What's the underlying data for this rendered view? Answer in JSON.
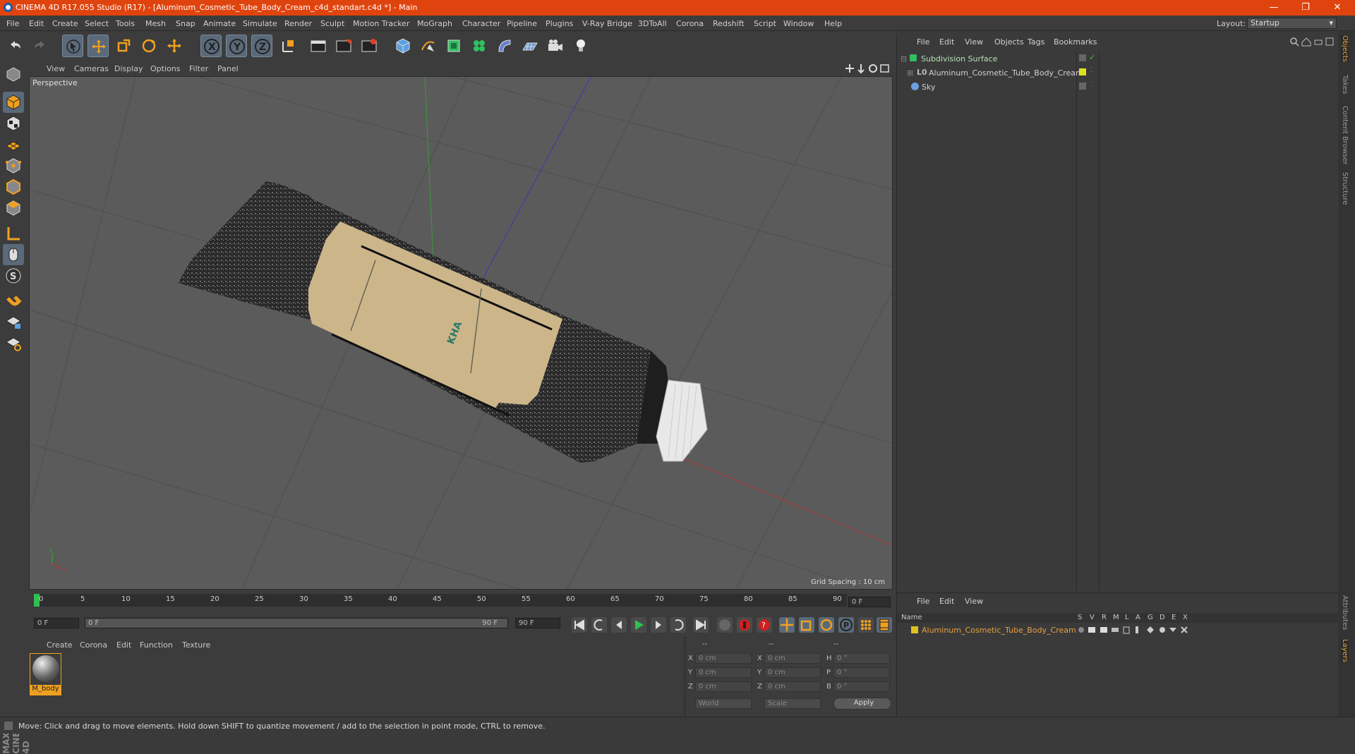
{
  "window": {
    "title": "CINEMA 4D R17.055 Studio (R17) - [Aluminum_Cosmetic_Tube_Body_Cream_c4d_standart.c4d *] - Main",
    "minimize": "—",
    "maximize": "❐",
    "close": "✕"
  },
  "menu": [
    "File",
    "Edit",
    "Create",
    "Select",
    "Tools",
    "Mesh",
    "Snap",
    "Animate",
    "Simulate",
    "Render",
    "Sculpt",
    "Motion Tracker",
    "MoGraph",
    "Character",
    "Pipeline",
    "Plugins",
    "V-Ray Bridge",
    "3DToAll",
    "Corona",
    "Redshift",
    "Script",
    "Window",
    "Help"
  ],
  "layout": {
    "label": "Layout:",
    "value": "Startup"
  },
  "viewport": {
    "menu": [
      "View",
      "Cameras",
      "Display",
      "Options",
      "Filter",
      "Panel"
    ],
    "camera": "Perspective",
    "grid_spacing": "Grid Spacing : 10 cm"
  },
  "timeline": {
    "labels": [
      "0",
      "5",
      "10",
      "15",
      "20",
      "25",
      "30",
      "35",
      "40",
      "45",
      "50",
      "55",
      "60",
      "65",
      "70",
      "75",
      "80",
      "85",
      "90"
    ],
    "current_frame": "0 F",
    "start_frame": "0 F",
    "range_start": "0 F",
    "range_end": "90 F",
    "end_frame": "90 F"
  },
  "material_panel": {
    "menu": [
      "Create",
      "Corona",
      "Edit",
      "Function",
      "Texture"
    ],
    "material_name": "M_body"
  },
  "coords": {
    "headers": [
      "--",
      "--",
      "--"
    ],
    "rows": [
      {
        "a": "X",
        "v1": "0 cm",
        "b": "X",
        "v2": "0 cm",
        "c": "H",
        "v3": "0 °"
      },
      {
        "a": "Y",
        "v1": "0 cm",
        "b": "Y",
        "v2": "0 cm",
        "c": "P",
        "v3": "0 °"
      },
      {
        "a": "Z",
        "v1": "0 cm",
        "b": "Z",
        "v2": "0 cm",
        "c": "B",
        "v3": "0 °"
      }
    ],
    "world": "World",
    "scale": "Scale",
    "apply": "Apply"
  },
  "objects_panel": {
    "menu": [
      "File",
      "Edit",
      "View",
      "Objects",
      "Tags",
      "Bookmarks"
    ],
    "objects": [
      {
        "name": "Subdivision Surface",
        "color": "#b8e0b8"
      },
      {
        "name": "Aluminum_Cosmetic_Tube_Body_Cream",
        "color": "#d0d0d0"
      },
      {
        "name": "Sky",
        "color": "#d0d0d0"
      }
    ]
  },
  "layers_panel": {
    "menu": [
      "File",
      "Edit",
      "View"
    ],
    "header": {
      "name": "Name",
      "cols": [
        "S",
        "V",
        "R",
        "M",
        "L",
        "A",
        "G",
        "D",
        "E",
        "X"
      ]
    },
    "layer_name": "Aluminum_Cosmetic_Tube_Body_Cream"
  },
  "right_tabs": [
    "Objects",
    "Takes",
    "Content Browser",
    "Structure",
    "Attributes",
    "Layers"
  ],
  "logo": "MAXON CINEMA 4D",
  "status": "Move: Click and drag to move elements. Hold down SHIFT to quantize movement / add to the selection in point mode, CTRL to remove.",
  "colors": {
    "title_bar": "#e0440e",
    "accent": "#e8a040",
    "viewport_bg": "#5b5b5b"
  }
}
